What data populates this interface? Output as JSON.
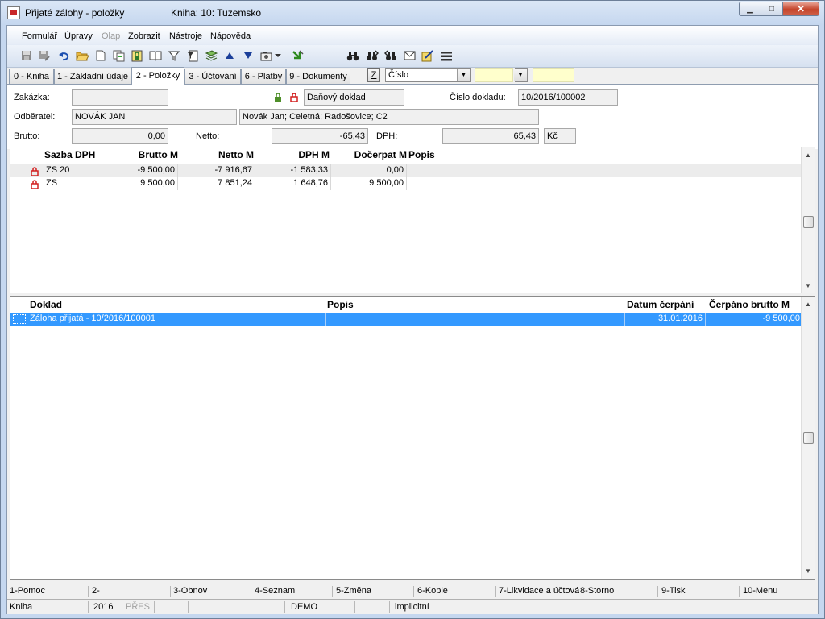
{
  "window": {
    "title": "Přijaté zálohy - položky",
    "book_title": "Kniha: 10: Tuzemsko",
    "minimize_glyph": "▁",
    "maximize_glyph": "□",
    "close_glyph": "✕"
  },
  "menu": {
    "items": [
      {
        "label": "Formulář",
        "disabled": false
      },
      {
        "label": "Úpravy",
        "disabled": false
      },
      {
        "label": "Olap",
        "disabled": true
      },
      {
        "label": "Zobrazit",
        "disabled": false
      },
      {
        "label": "Nástroje",
        "disabled": false
      },
      {
        "label": "Nápověda",
        "disabled": false
      }
    ]
  },
  "toolbar": {
    "icons": [
      "save-icon",
      "save-as-icon",
      "undo-icon",
      "open-folder-icon",
      "new-document-icon",
      "copy-icon",
      "lock-icon",
      "book-icon",
      "filter-icon",
      "document-filter-icon",
      "layers-icon",
      "arrow-up-icon",
      "arrow-down-icon",
      "camera-icon",
      "dropdown-arrow-icon",
      "green-arrow-icon",
      "binoculars-icon",
      "find-next-icon",
      "find-prev-icon",
      "mail-icon",
      "note-icon",
      "menu-lines-icon"
    ]
  },
  "tabs": {
    "items": [
      {
        "label": "0 - Kniha",
        "active": false
      },
      {
        "label": "1 - Základní údaje",
        "active": false
      },
      {
        "label": "2 - Položky",
        "active": true
      },
      {
        "label": "3 - Účtování",
        "active": false
      },
      {
        "label": "6 - Platby",
        "active": false
      },
      {
        "label": "9 - Dokumenty",
        "active": false
      }
    ],
    "z_button": "Z",
    "sort_combo": "Číslo"
  },
  "form": {
    "zakazka_label": "Zakázka:",
    "zakazka_value": "",
    "danovy_doklad": "Daňový doklad",
    "cislo_dokladu_label": "Číslo dokladu:",
    "cislo_dokladu_value": "10/2016/100002",
    "odberatel_label": "Odběratel:",
    "odberatel_value": "NOVÁK JAN",
    "odberatel_address": "Novák Jan; Celetná; Radošovice; C2",
    "brutto_label": "Brutto:",
    "brutto_value": "0,00",
    "netto_label": "Netto:",
    "netto_value": "-65,43",
    "dph_label": "DPH:",
    "dph_value": "65,43",
    "currency": "Kč"
  },
  "vat_grid": {
    "headers": [
      "Sazba DPH",
      "Brutto M",
      "Netto M",
      "DPH M",
      "Dočerpat M",
      "Popis"
    ],
    "rows": [
      {
        "sazba": "ZS 20",
        "brutto": "-9 500,00",
        "netto": "-7 916,67",
        "dph": "-1 583,33",
        "docerpat": "0,00",
        "popis": ""
      },
      {
        "sazba": "ZS",
        "brutto": "9 500,00",
        "netto": "7 851,24",
        "dph": "1 648,76",
        "docerpat": "9 500,00",
        "popis": ""
      }
    ]
  },
  "doc_grid": {
    "headers": [
      "Doklad",
      "Popis",
      "Datum čerpání",
      "Čerpáno brutto M"
    ],
    "rows": [
      {
        "doklad": "Záloha přijatá - 10/2016/100001",
        "popis": "",
        "datum": "31.01.2016",
        "cerpano": "-9 500,00",
        "selected": true
      }
    ]
  },
  "colors": {
    "selection": "#3399ff",
    "lock_red": "#d22020",
    "lock_green": "#4f8f2a"
  },
  "fkeys": [
    "1-Pomoc",
    "2-",
    "3-Obnov",
    "4-Seznam",
    "5-Změna",
    "6-Kopie",
    "7-Likvidace a účtová",
    "8-Storno",
    "9-Tisk",
    "10-Menu"
  ],
  "status": {
    "kniha": "Kniha",
    "year": "2016",
    "pres": "PŘES",
    "db": "DEMO",
    "mode": "implicitní"
  }
}
